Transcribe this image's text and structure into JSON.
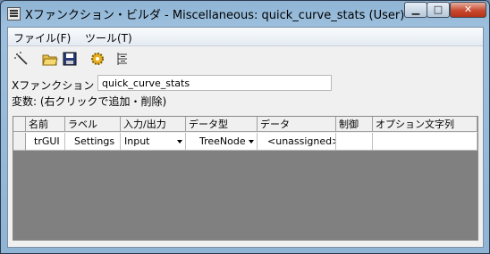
{
  "window": {
    "title": "Xファンクション・ビルダ - Miscellaneous: quick_curve_stats (User)"
  },
  "menu": {
    "items": [
      "ファイル(F)",
      "ツール(T)"
    ]
  },
  "toolbar": {
    "buttons": [
      "new-wand-icon",
      "open-folder-icon",
      "save-disk-icon",
      "settings-gear-icon",
      "tree-view-icon"
    ]
  },
  "form": {
    "xfunction_label": "Xファンクション",
    "xfunction_value": "quick_curve_stats",
    "variables_label": "変数: (右クリックで追加・削除)"
  },
  "grid": {
    "columns": [
      "名前",
      "ラベル",
      "入力/出力",
      "データ型",
      "データ",
      "制御",
      "オプション文字列"
    ],
    "rows": [
      {
        "name": "trGUI",
        "label": "Settings",
        "io": "Input",
        "type": "TreeNode",
        "data": "<unassigned>",
        "control": "",
        "options": ""
      }
    ]
  }
}
